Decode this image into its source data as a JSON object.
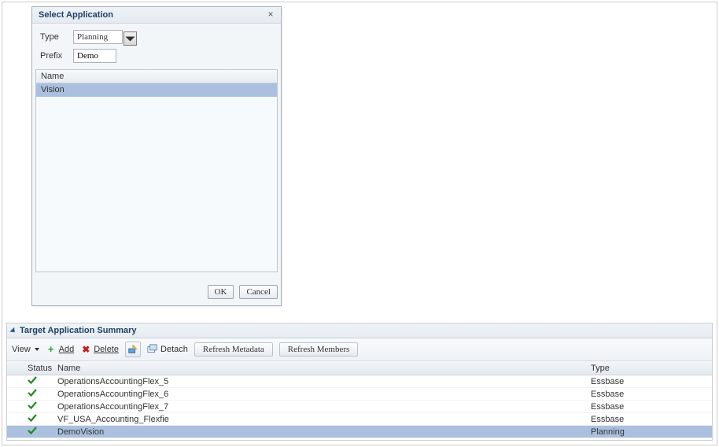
{
  "dialog": {
    "title": "Select Application",
    "type_label": "Type",
    "type_value": "Planning",
    "prefix_label": "Prefix",
    "prefix_value": "Demo",
    "list_header": "Name",
    "items": [
      {
        "name": "Vision",
        "selected": true
      }
    ],
    "ok_label": "OK",
    "cancel_label": "Cancel"
  },
  "summary": {
    "title": "Target Application Summary",
    "toolbar": {
      "view_label": "View",
      "add_label": "Add",
      "delete_label": "Delete",
      "detach_label": "Detach",
      "refresh_metadata_label": "Refresh Metadata",
      "refresh_members_label": "Refresh Members"
    },
    "columns": {
      "status": "Status",
      "name": "Name",
      "type": "Type"
    },
    "rows": [
      {
        "status": "ok",
        "name": "OperationsAccountingFlex_5",
        "type": "Essbase",
        "selected": false
      },
      {
        "status": "ok",
        "name": "OperationsAccountingFlex_6",
        "type": "Essbase",
        "selected": false
      },
      {
        "status": "ok",
        "name": "OperationsAccountingFlex_7",
        "type": "Essbase",
        "selected": false
      },
      {
        "status": "ok",
        "name": "VF_USA_Accounting_Flexfie",
        "type": "Essbase",
        "selected": false
      },
      {
        "status": "ok",
        "name": "DemoVision",
        "type": "Planning",
        "selected": true
      }
    ]
  }
}
